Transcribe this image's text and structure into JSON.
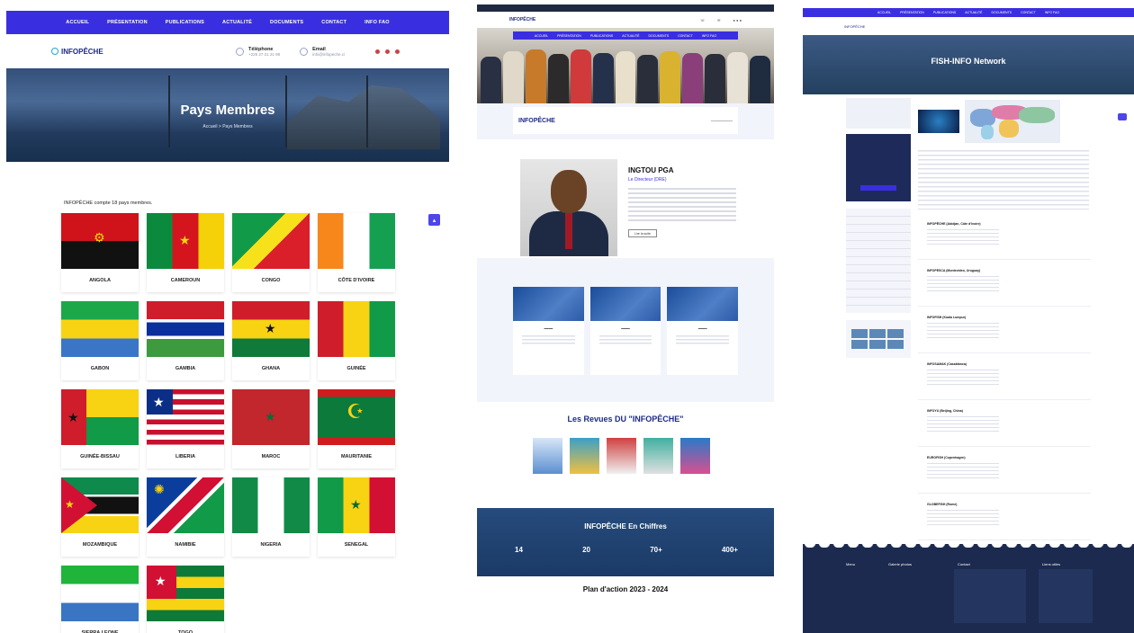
{
  "panel1": {
    "nav": [
      "ACCUEIL",
      "PRÉSENTATION",
      "PUBLICATIONS",
      "ACTUALITÉ",
      "DOCUMENTS",
      "CONTACT",
      "INFO FAO"
    ],
    "logo": "INFOPÊCHE",
    "phone_label": "Téléphone",
    "phone_value": "+225 27 21 21 98",
    "email_label": "Email",
    "email_value": "info@infopeche.ci",
    "hero_title": "Pays Membres",
    "breadcrumb": "Accueil  >  Pays Membres",
    "count_text": "INFOPÊCHE compte 18 pays membres.",
    "countries": [
      "ANGOLA",
      "CAMEROUN",
      "CONGO",
      "CÔTE D'IVOIRE",
      "GABON",
      "GAMBIA",
      "GHANA",
      "GUINÉE",
      "GUINÉE-BISSAU",
      "LIBERIA",
      "MAROC",
      "MAURITANIE",
      "MOZAMBIQUE",
      "NAMIBIE",
      "NIGERIA",
      "SENEGAL",
      "SIERRA LEONE",
      "TOGO"
    ]
  },
  "panel2": {
    "logo": "INFOPÊCHE",
    "nav": [
      "ACCUEIL",
      "PRÉSENTATION",
      "PUBLICATIONS",
      "ACTUALITÉ",
      "DOCUMENTS",
      "CONTACT",
      "INFO FAO"
    ],
    "mission_title": "INFOPÊCHE",
    "sg_name": "INGTOU PGA",
    "sg_role": "Le Directeur (DRE)",
    "sg_button": "Lire la suite",
    "revues_title": "Les Revues DU \"INFOPÊCHE\"",
    "chiffres_title": "INFOPÊCHE En Chiffres",
    "chiffres": [
      "14",
      "20",
      "70+",
      "400+"
    ],
    "plan_title": "Plan d'action 2023 - 2024"
  },
  "panel3": {
    "nav": [
      "ACCUEIL",
      "PRÉSENTATION",
      "PUBLICATIONS",
      "ACTUALITÉ",
      "DOCUMENTS",
      "CONTACT",
      "INFO FAO"
    ],
    "logo": "INFOPÊCHE",
    "hero_title": "FISH-INFO Network",
    "items": [
      "INFOPÊCHE (Abidjan, Côte d'Ivoire)",
      "INFOPESCA (Montevideo, Uruguay)",
      "INFOFISH (Kuala Lumpur)",
      "INFOSAMAK (Casablanca)",
      "INFOYU (Beijing, China)",
      "EUROFISH (Copenhagen)",
      "GLOBEFISH (Rome)"
    ],
    "footer_cols": [
      "Menu",
      "Galerie photos",
      "Contact",
      "Liens utiles"
    ]
  }
}
